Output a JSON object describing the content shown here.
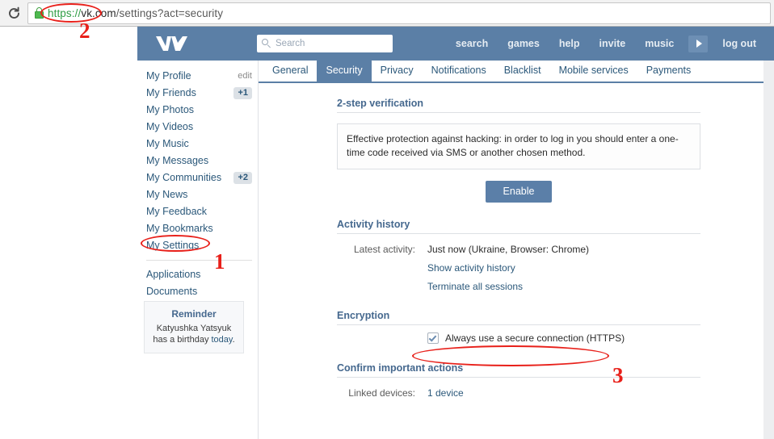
{
  "browser": {
    "reload_icon": "reload-icon",
    "lock_icon": "secure-lock-icon",
    "url_scheme": "https",
    "url_sep": "://",
    "url_host": "vk.com",
    "url_path": "/settings?act=security"
  },
  "header": {
    "logo": "vk-logo",
    "search": {
      "icon": "search-icon",
      "placeholder": "Search",
      "value": ""
    },
    "nav": [
      {
        "label": "search",
        "name": "nav-search"
      },
      {
        "label": "games",
        "name": "nav-games"
      },
      {
        "label": "help",
        "name": "nav-help"
      },
      {
        "label": "invite",
        "name": "nav-invite"
      },
      {
        "label": "music",
        "name": "nav-music"
      },
      {
        "label": "log out",
        "name": "nav-logout"
      }
    ],
    "play_icon": "play-icon"
  },
  "sidebar": {
    "items": [
      {
        "label": "My Profile",
        "aux": "edit",
        "aux_type": "edit"
      },
      {
        "label": "My Friends",
        "aux": "+1",
        "aux_type": "badge"
      },
      {
        "label": "My Photos",
        "aux": "",
        "aux_type": "none"
      },
      {
        "label": "My Videos",
        "aux": "",
        "aux_type": "none"
      },
      {
        "label": "My Music",
        "aux": "",
        "aux_type": "none"
      },
      {
        "label": "My Messages",
        "aux": "",
        "aux_type": "none"
      },
      {
        "label": "My Communities",
        "aux": "+2",
        "aux_type": "badge"
      },
      {
        "label": "My News",
        "aux": "",
        "aux_type": "none"
      },
      {
        "label": "My Feedback",
        "aux": "",
        "aux_type": "none"
      },
      {
        "label": "My Bookmarks",
        "aux": "",
        "aux_type": "none"
      },
      {
        "label": "My Settings",
        "aux": "",
        "aux_type": "none"
      }
    ],
    "items_secondary": [
      {
        "label": "Applications"
      },
      {
        "label": "Documents"
      }
    ],
    "reminder": {
      "title": "Reminder",
      "line1": "Katyushka Yatsyuk",
      "line2_pre": "has a birthday ",
      "line2_link": "today",
      "line2_post": "."
    }
  },
  "tabs": [
    {
      "label": "General",
      "active": false
    },
    {
      "label": "Security",
      "active": true
    },
    {
      "label": "Privacy",
      "active": false
    },
    {
      "label": "Notifications",
      "active": false
    },
    {
      "label": "Blacklist",
      "active": false
    },
    {
      "label": "Mobile services",
      "active": false
    },
    {
      "label": "Payments",
      "active": false
    }
  ],
  "main": {
    "two_step": {
      "title": "2-step verification",
      "description": "Effective protection against hacking: in order to log in you should enter a one-time code received via SMS or another chosen method.",
      "enable_label": "Enable"
    },
    "activity": {
      "title": "Activity history",
      "latest_label": "Latest activity:",
      "latest_value": "Just now (Ukraine, Browser: Chrome)",
      "show_history_link": "Show activity history",
      "terminate_link": "Terminate all sessions"
    },
    "encryption": {
      "title": "Encryption",
      "checkbox_label": "Always use a secure connection (HTTPS)",
      "checkbox_checked": true,
      "check_icon": "check-icon"
    },
    "confirm": {
      "title": "Confirm important actions",
      "linked_label": "Linked devices:",
      "linked_value": "1 device"
    }
  },
  "annotations": {
    "color": "#e8201a",
    "marks": [
      {
        "number": "1",
        "target": "my-settings-sidebar-item"
      },
      {
        "number": "2",
        "target": "https-scheme-in-url"
      },
      {
        "number": "3",
        "target": "https-checkbox"
      }
    ]
  }
}
